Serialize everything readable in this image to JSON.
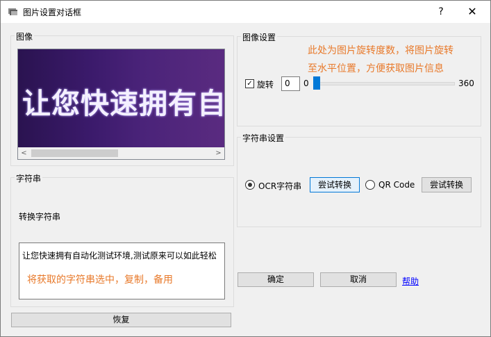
{
  "window": {
    "title": "图片设置对话框",
    "help_label": "?",
    "close_label": "✕"
  },
  "image_group": {
    "label": "图像",
    "banner_text": "让您快速拥有自动化测试环",
    "scroll_left": "<",
    "scroll_right": ">"
  },
  "image_settings": {
    "label": "图像设置",
    "annotation_line1": "此处为图片旋转度数，将图片旋转",
    "annotation_line2": "至水平位置，方便获取图片信息",
    "rotate_checked": true,
    "rotate_label": "旋转",
    "rotate_value": "0",
    "slider_min": "0",
    "slider_max": "360",
    "slider_value": 0
  },
  "string_settings": {
    "label": "字符串设置",
    "ocr_label": "OCR字符串",
    "ocr_selected": true,
    "ocr_try_button": "尝试转换",
    "qr_label": "QR Code",
    "qr_selected": false,
    "qr_try_button": "尝试转换"
  },
  "string_group": {
    "label": "字符串",
    "convert_label": "转换字符串",
    "text_value": "让您快速拥有自动化测试环境,测试原来可以如此轻松",
    "annotation": "将获取的字符串选中，复制，备用"
  },
  "buttons": {
    "restore": "恢复",
    "ok": "确定",
    "cancel": "取消",
    "help": "帮助"
  },
  "colors": {
    "annotation": "#e8792a",
    "accent": "#0078d7",
    "link": "#0000ff"
  }
}
